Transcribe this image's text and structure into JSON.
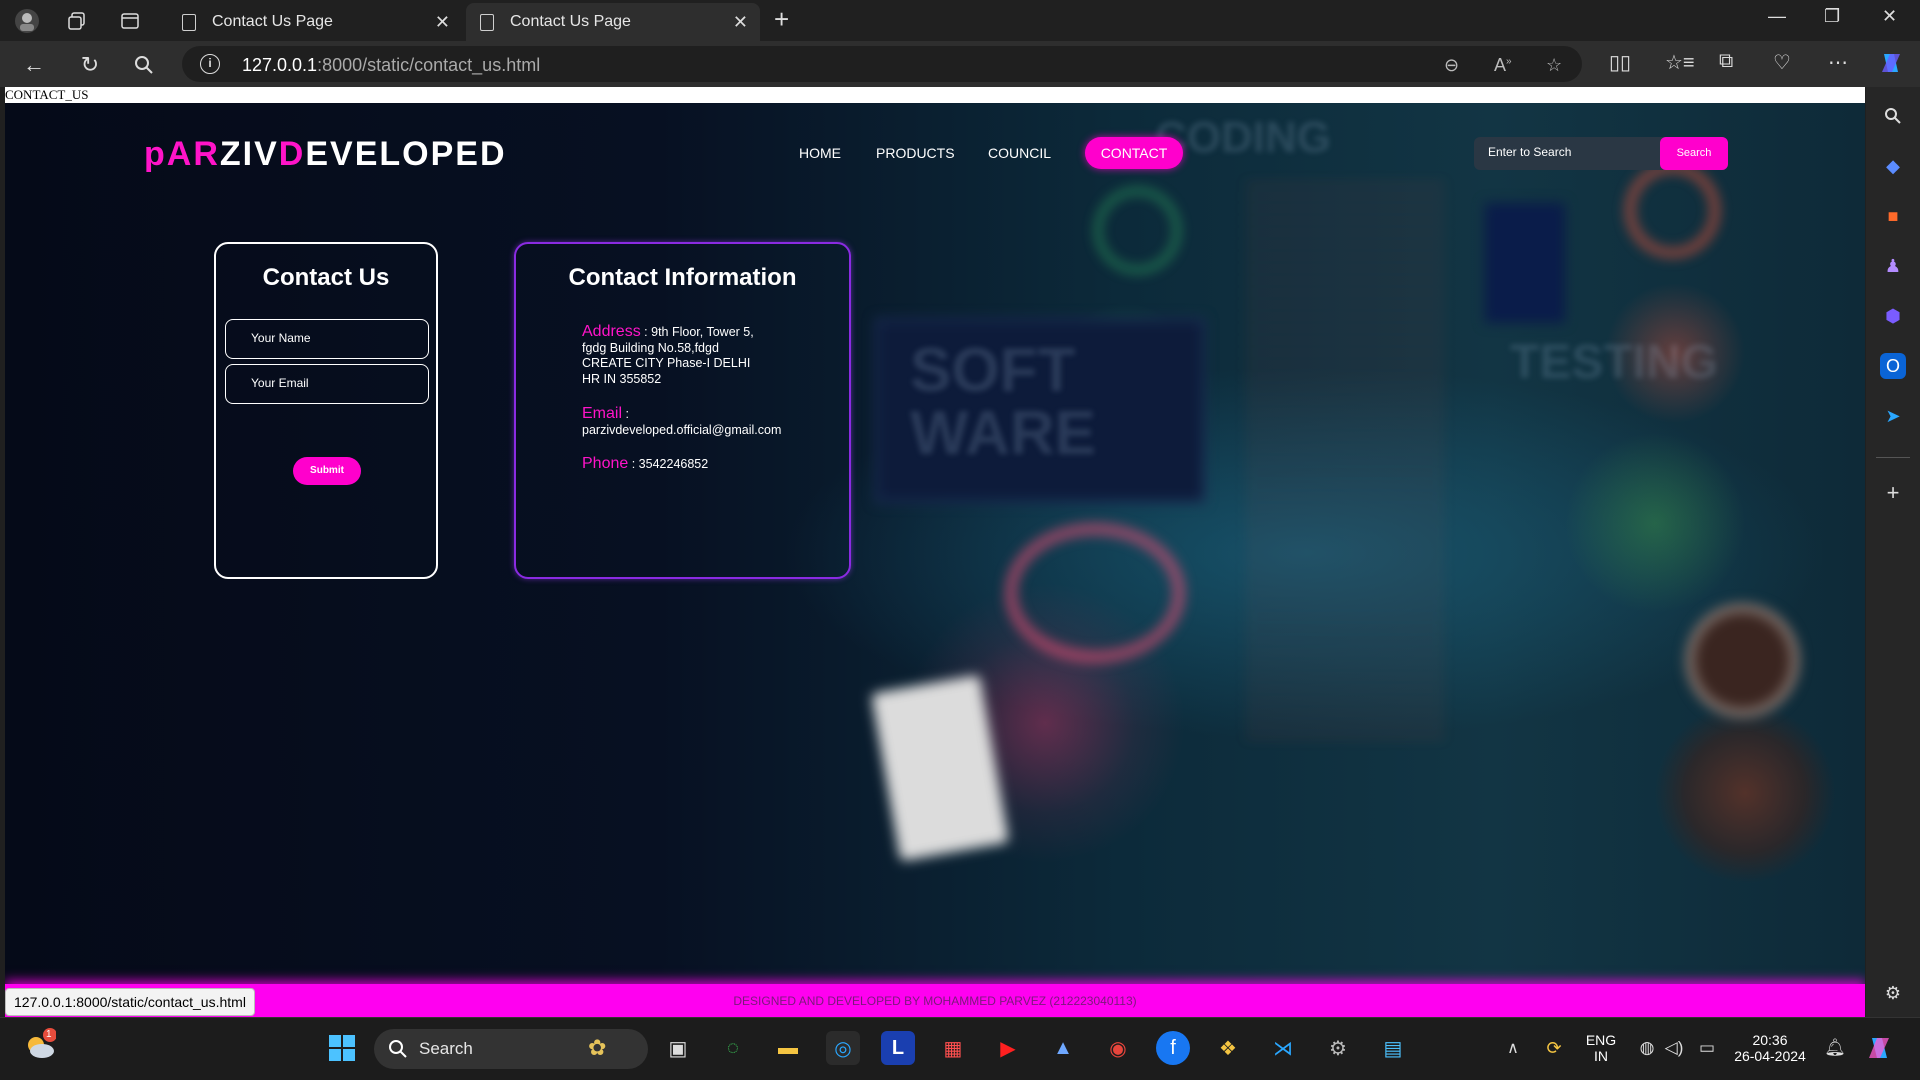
{
  "browser": {
    "tabs": [
      {
        "title": "Contact Us Page"
      },
      {
        "title": "Contact Us Page"
      }
    ],
    "url_host": "127.0.0.1",
    "url_rest": ":8000/static/contact_us.html",
    "status_url": "127.0.0.1:8000/static/contact_us.html"
  },
  "page": {
    "label": "CONTACT_US",
    "logo": {
      "p": "pAR",
      "z": "ZIV",
      "d": "D",
      "rest": "EVELOPED"
    },
    "nav": [
      "HOME",
      "PRODUCTS",
      "COUNCIL",
      "CONTACT"
    ],
    "search": {
      "placeholder": "Enter to Search",
      "button": "Search"
    },
    "form": {
      "title": "Contact Us",
      "name_placeholder": "Your Name",
      "email_placeholder": "Your Email",
      "submit": "Submit"
    },
    "info": {
      "title": "Contact Information",
      "address_label": "Address",
      "address_line1": " : 9th Floor, Tower 5,",
      "address_line2": "fgdg Building No.58,fdgd",
      "address_line3": "CREATE CITY Phase-I DELHI",
      "address_line4": "HR IN 355852",
      "email_label": "Email",
      "email_sep": " :",
      "email_value": "parzivdeveloped.official@gmail.com",
      "phone_label": "Phone",
      "phone_value": " : 3542246852"
    },
    "footer": "DESIGNED AND DEVELOPED BY MOHAMMED PARVEZ (212223040113)",
    "background_words": [
      "SOFT",
      "WARE",
      "TESTING",
      "CODING"
    ]
  },
  "taskbar": {
    "search": "Search",
    "lang_top": "ENG",
    "lang_bottom": "IN",
    "time": "20:36",
    "date": "26-04-2024",
    "weather_badge": "1"
  },
  "colors": {
    "accent": "#ff00cc",
    "info_border": "#8a2be2",
    "footer": "#ff00f0"
  }
}
